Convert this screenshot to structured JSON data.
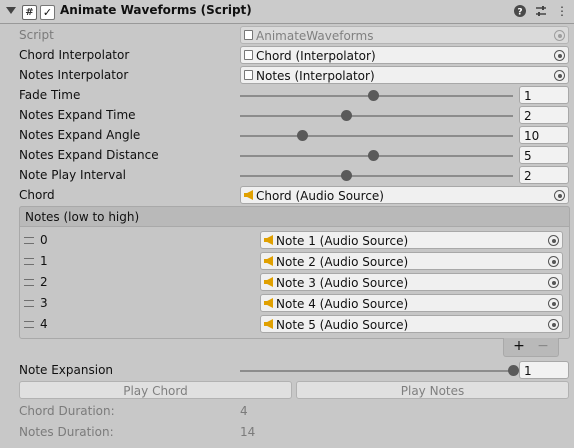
{
  "header": {
    "title": "Animate Waveforms (Script)",
    "script_icon_glyph": "#",
    "checkbox_checked_glyph": "✓",
    "help_glyph": "?",
    "preset_glyph": "⇌",
    "menu_glyph": "⋮"
  },
  "fields": {
    "script": {
      "label": "Script",
      "value": "AnimateWaveforms"
    },
    "chord_interpolator": {
      "label": "Chord Interpolator",
      "value": "Chord (Interpolator)"
    },
    "notes_interpolator": {
      "label": "Notes Interpolator",
      "value": "Notes (Interpolator)"
    },
    "fade_time": {
      "label": "Fade Time",
      "value": "1",
      "fraction": 0.49
    },
    "notes_expand_time": {
      "label": "Notes Expand Time",
      "value": "2",
      "fraction": 0.39
    },
    "notes_expand_angle": {
      "label": "Notes Expand Angle",
      "value": "10",
      "fraction": 0.23
    },
    "notes_expand_distance": {
      "label": "Notes Expand Distance",
      "value": "5",
      "fraction": 0.49
    },
    "note_play_interval": {
      "label": "Note Play Interval",
      "value": "2",
      "fraction": 0.39
    },
    "chord": {
      "label": "Chord",
      "value": "Chord (Audio Source)"
    }
  },
  "notes_list": {
    "header": "Notes (low to high)",
    "items": [
      {
        "index": "0",
        "value": "Note 1 (Audio Source)"
      },
      {
        "index": "1",
        "value": "Note 2 (Audio Source)"
      },
      {
        "index": "2",
        "value": "Note 3 (Audio Source)"
      },
      {
        "index": "3",
        "value": "Note 4 (Audio Source)"
      },
      {
        "index": "4",
        "value": "Note 5 (Audio Source)"
      }
    ],
    "add_label": "+",
    "remove_label": "−"
  },
  "note_expansion": {
    "label": "Note Expansion",
    "value": "1",
    "fraction": 1.0
  },
  "buttons": {
    "play_chord": "Play Chord",
    "play_notes": "Play Notes"
  },
  "info": {
    "chord_duration": {
      "label": "Chord Duration:",
      "value": "4"
    },
    "notes_duration": {
      "label": "Notes Duration:",
      "value": "14"
    }
  },
  "colors": {
    "background": "#c8c8c8",
    "speaker_icon": "#e0a000",
    "knob": "#5a5a5a"
  },
  "icons": {
    "script": "script-icon",
    "audio": "speaker-icon",
    "picker": "object-picker-icon",
    "help": "help-icon",
    "preset": "preset-icon",
    "menu": "kebab-menu-icon",
    "drag": "drag-handle-icon"
  }
}
